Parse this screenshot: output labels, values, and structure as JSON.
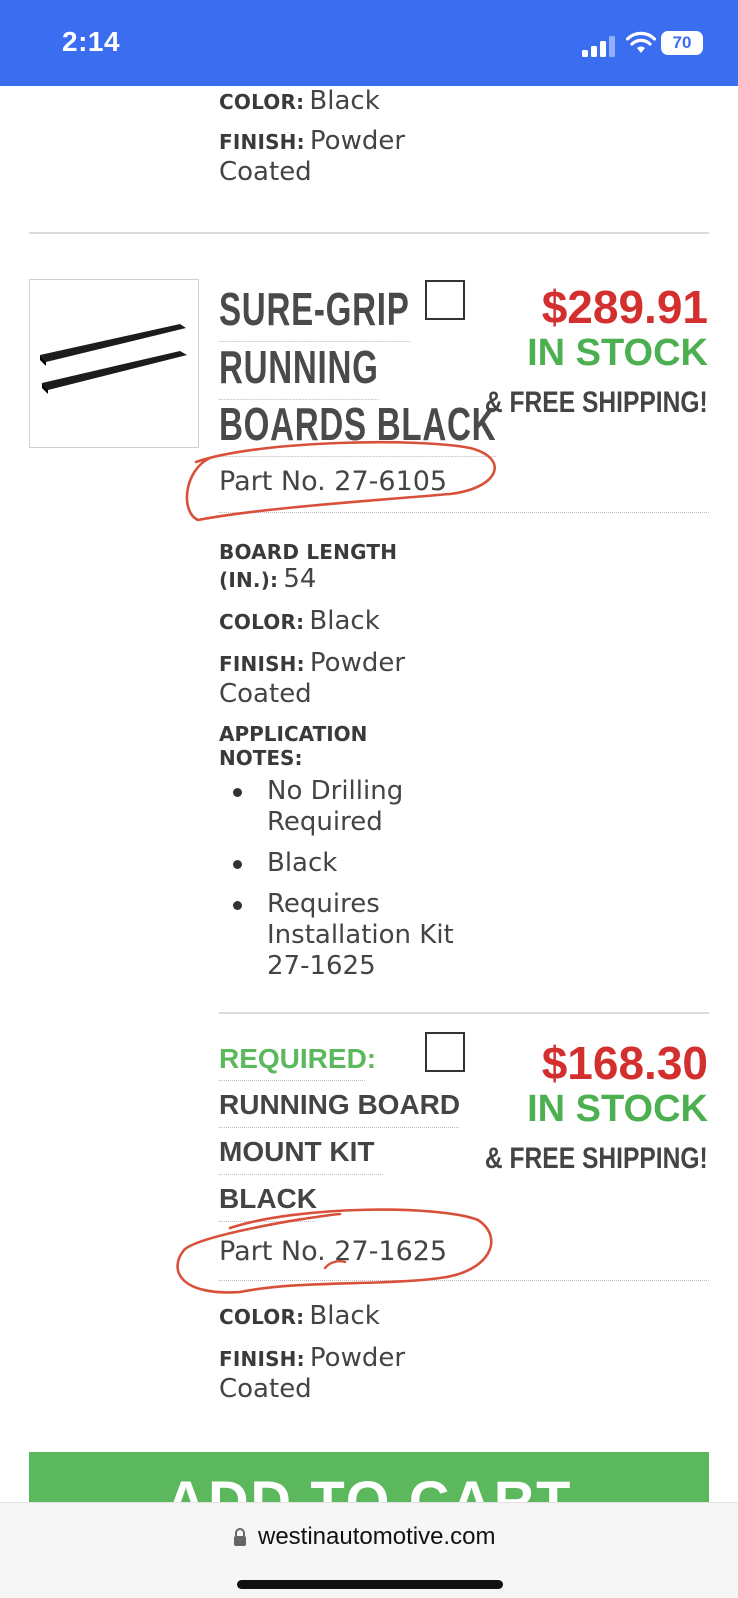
{
  "status_bar": {
    "time": "2:14",
    "battery": "70",
    "icons": [
      "signal-icon",
      "wifi-icon",
      "battery-icon"
    ]
  },
  "prev_item": {
    "color_label": "COLOR:",
    "color_value": "Black",
    "finish_label": "FINISH:",
    "finish_value_1": "Powder",
    "finish_value_2": "Coated"
  },
  "item1": {
    "title_lines": [
      "SURE-GRIP",
      "RUNNING",
      "BOARDS BLACK"
    ],
    "part_no": "Part No. 27-6105",
    "price": "$289.91",
    "stock": "IN STOCK",
    "shipping": "& FREE SHIPPING!",
    "board_length_label_1": "BOARD LENGTH",
    "board_length_label_2": "(IN.):",
    "board_length_value": "54",
    "color_label": "COLOR:",
    "color_value": "Black",
    "finish_label": "FINISH:",
    "finish_value_1": "Powder",
    "finish_value_2": "Coated",
    "notes_label_1": "APPLICATION",
    "notes_label_2": "NOTES:",
    "notes": [
      [
        "No Drilling",
        "Required"
      ],
      [
        "Black"
      ],
      [
        "Requires",
        "Installation Kit",
        "27-1625"
      ]
    ]
  },
  "item2": {
    "required_label": "REQUIRED:",
    "title_lines": [
      "RUNNING BOARD",
      "MOUNT KIT",
      "BLACK"
    ],
    "part_no": "Part No. 27-1625",
    "price": "$168.30",
    "stock": "IN STOCK",
    "shipping": "& FREE SHIPPING!",
    "color_label": "COLOR:",
    "color_value": "Black",
    "finish_label": "FINISH:",
    "finish_value_1": "Powder",
    "finish_value_2": "Coated"
  },
  "cart_button": {
    "label": "ADD TO CART"
  },
  "browser": {
    "url": "westinautomotive.com"
  },
  "colors": {
    "status_bar": "#3a6df0",
    "price": "#d32f2f",
    "stock": "#4caf50",
    "cart": "#5cb85c",
    "annotation": "#d9503a"
  }
}
